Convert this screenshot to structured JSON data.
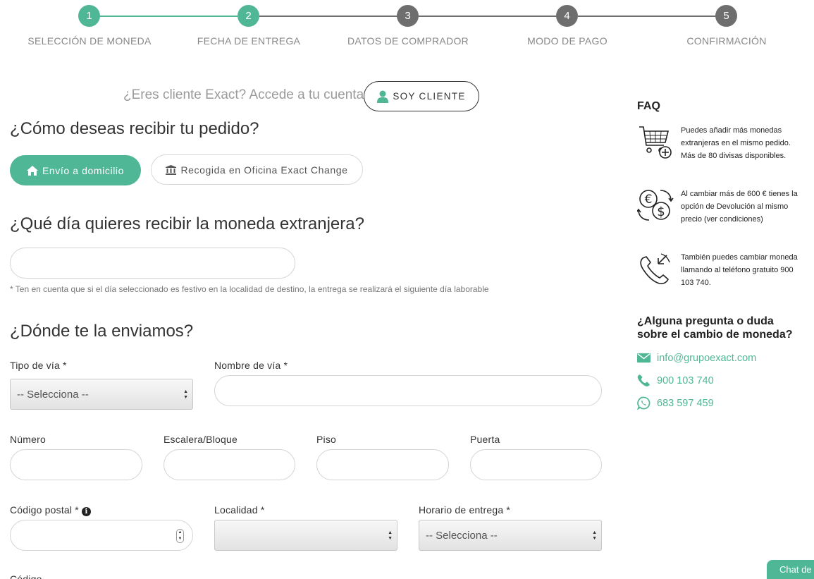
{
  "stepper": {
    "steps": [
      {
        "number": "1",
        "label": "SELECCIÓN DE MONEDA"
      },
      {
        "number": "2",
        "label": "FECHA DE ENTREGA"
      },
      {
        "number": "3",
        "label": "DATOS DE COMPRADOR"
      },
      {
        "number": "4",
        "label": "MODO DE PAGO"
      },
      {
        "number": "5",
        "label": "CONFIRMACIÓN"
      }
    ],
    "active_color": "#4fb795",
    "inactive_color": "#6e6e6e"
  },
  "client": {
    "prompt": "¿Eres cliente Exact? Accede a tu cuenta",
    "button_label": "SOY CLIENTE"
  },
  "delivery": {
    "question": "¿Cómo deseas recibir tu pedido?",
    "home_label": "Envío a domicilio",
    "office_label": "Recogida en Oficina Exact Change"
  },
  "date": {
    "question": "¿Qué día quieres recibir la moneda extranjera?",
    "value": "",
    "note": "* Ten en cuenta que si el día seleccionado es festivo en la localidad de destino, la entrega se realizará el siguiente día laborable"
  },
  "address": {
    "question": "¿Dónde te la enviamos?",
    "tipo_via_label": "Tipo de vía *",
    "tipo_via_value": "-- Selecciona --",
    "nombre_via_label": "Nombre de vía *",
    "numero_label": "Número",
    "escalera_label": "Escalera/Bloque",
    "piso_label": "Piso",
    "puerta_label": "Puerta",
    "codigo_postal_label": "Código postal *",
    "localidad_label": "Localidad *",
    "horario_label": "Horario de entrega *",
    "horario_value": "-- Selecciona --",
    "next_label_partial": "Código"
  },
  "sidebar": {
    "faq_title": "FAQ",
    "faq_items": [
      {
        "icon": "cart-plus-icon",
        "text": "Puedes añadir más monedas extranjeras en el mismo pedido. Más de 80 divisas disponibles."
      },
      {
        "icon": "currency-exchange-icon",
        "text": "Al cambiar más de 600 € tienes la opción de Devolución al mismo precio (ver condiciones)"
      },
      {
        "icon": "phone-call-icon",
        "text": "También puedes cambiar moneda llamando al teléfono gratuito 900 103 740."
      }
    ],
    "doubt_title": "¿Alguna pregunta o duda sobre el cambio de moneda?",
    "email": "info@grupoexact.com",
    "phone": "900 103 740",
    "whatsapp": "683 597 459"
  },
  "chat": {
    "label": "Chat de"
  }
}
